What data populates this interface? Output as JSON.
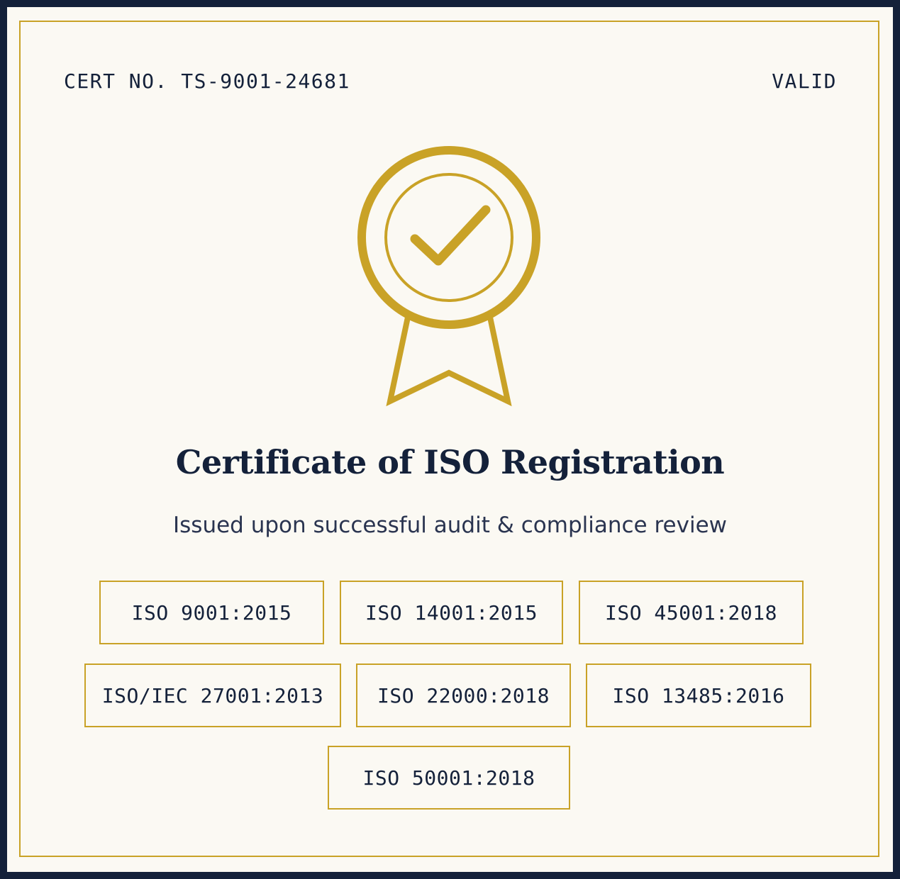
{
  "header": {
    "certificate_number": "CERT NO. TS-9001-24681",
    "status": "VALID"
  },
  "seal": {
    "icon": "award-ribbon-check-icon",
    "color": "#c9a227"
  },
  "title": "Certificate of ISO Registration",
  "subtitle": "Issued upon successful audit & compliance review",
  "standards": [
    "ISO 9001:2015",
    "ISO 14001:2015",
    "ISO 45001:2018",
    "ISO/IEC 27001:2013",
    "ISO 22000:2018",
    "ISO 13485:2016",
    "ISO 50001:2018"
  ],
  "colors": {
    "background": "#14213a",
    "paper": "#fbf9f3",
    "gold": "#c9a227",
    "ink": "#14213a"
  }
}
